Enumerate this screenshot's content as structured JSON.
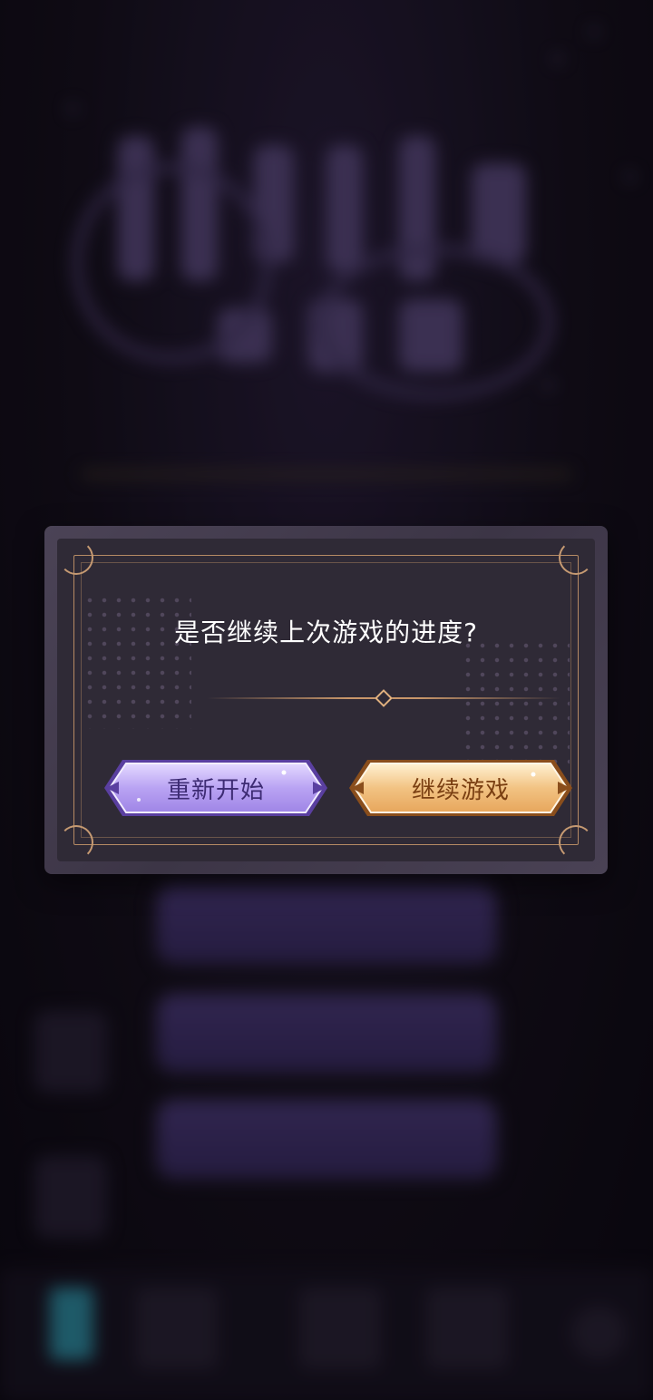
{
  "dialog": {
    "title": "是否继续上次游戏的进度?",
    "restart_label": "重新开始",
    "continue_label": "继续游戏"
  },
  "colors": {
    "dialog_bg": "#2f2a36",
    "frame_gold": "#c8966a",
    "restart_button": "#b9a3f3",
    "continue_button": "#f2c383"
  }
}
